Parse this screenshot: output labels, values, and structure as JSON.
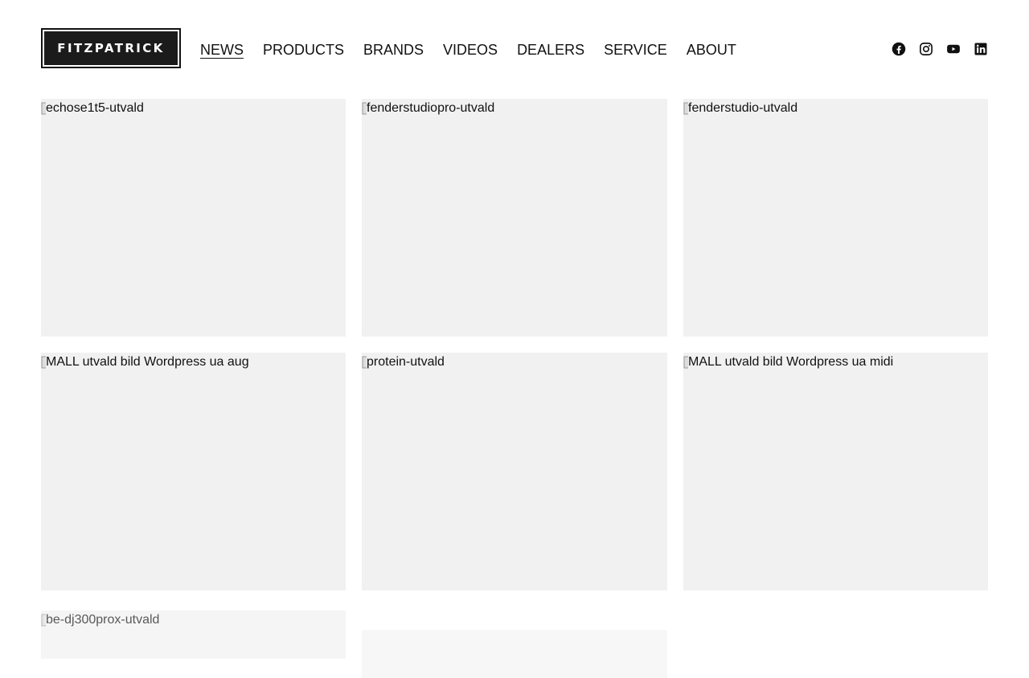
{
  "header": {
    "logo_text": "FITZPATRICK",
    "nav": [
      {
        "label": "NEWS",
        "active": true
      },
      {
        "label": "PRODUCTS",
        "active": false
      },
      {
        "label": "BRANDS",
        "active": false
      },
      {
        "label": "VIDEOS",
        "active": false
      },
      {
        "label": "DEALERS",
        "active": false
      },
      {
        "label": "SERVICE",
        "active": false
      },
      {
        "label": "ABOUT",
        "active": false
      }
    ],
    "social": [
      "facebook-icon",
      "instagram-icon",
      "youtube-icon",
      "linkedin-icon"
    ]
  },
  "posts": [
    {
      "alt": "echose1t5-utvald"
    },
    {
      "alt": "fenderstudiopro-utvald"
    },
    {
      "alt": "fenderstudio-utvald"
    },
    {
      "alt": "MALL utvald bild Wordpress ua aug"
    },
    {
      "alt": "protein-utvald"
    },
    {
      "alt": "MALL utvald bild Wordpress ua midi"
    },
    {
      "alt": "be-dj300prox-utvald"
    }
  ],
  "colors": {
    "placeholder_bg": "#f1f1f1",
    "text": "#111111",
    "logo_bg": "#1b1b1b"
  }
}
